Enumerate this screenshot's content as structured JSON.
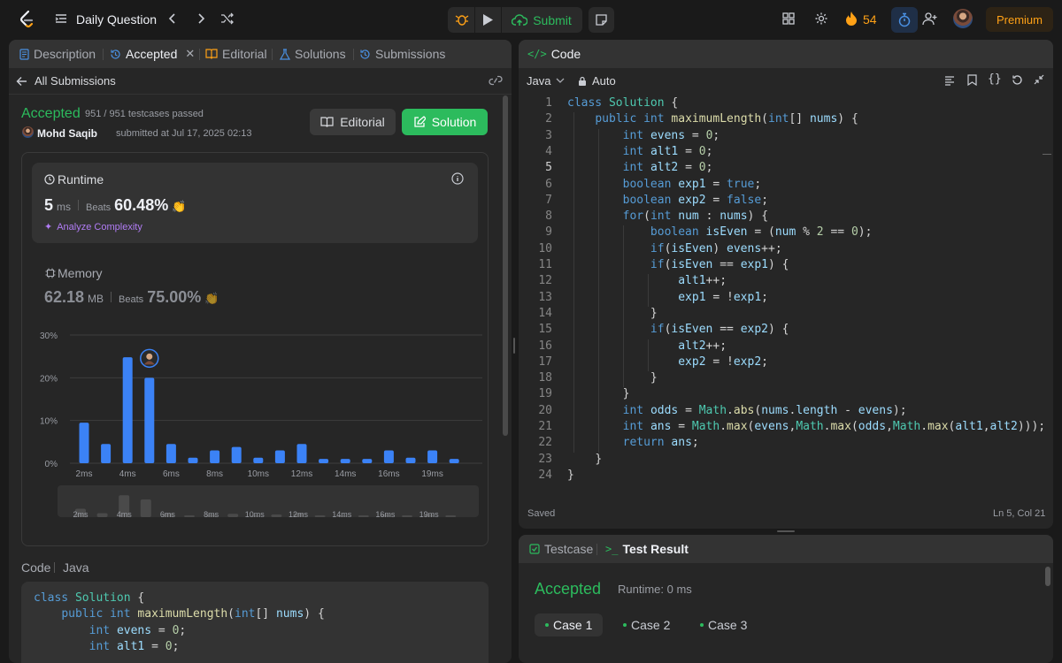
{
  "topbar": {
    "title": "Daily Question",
    "submit_label": "Submit",
    "streak": "54",
    "premium_label": "Premium"
  },
  "left_tabs": [
    {
      "label": "Description"
    },
    {
      "label": "Accepted"
    },
    {
      "label": "Editorial"
    },
    {
      "label": "Solutions"
    },
    {
      "label": "Submissions"
    }
  ],
  "submission": {
    "back_label": "All Submissions",
    "status": "Accepted",
    "testcases": "951 / 951 testcases passed",
    "user": "Mohd Saqib",
    "submitted_at": "submitted at Jul 17, 2025 02:13",
    "editorial_btn": "Editorial",
    "solution_btn": "Solution"
  },
  "runtime": {
    "label": "Runtime",
    "value": "5",
    "unit": "ms",
    "beats_label": "Beats",
    "beats": "60.48%",
    "analyze": "Analyze Complexity"
  },
  "memory": {
    "label": "Memory",
    "value": "62.18",
    "unit": "MB",
    "beats_label": "Beats",
    "beats": "75.00%"
  },
  "chart_data": {
    "type": "bar",
    "y_ticks": [
      "30%",
      "20%",
      "10%",
      "0%"
    ],
    "ylim": [
      0,
      30
    ],
    "x_labels": [
      "2ms",
      "4ms",
      "6ms",
      "8ms",
      "10ms",
      "12ms",
      "14ms",
      "16ms",
      "19ms"
    ],
    "values": [
      9.5,
      4.5,
      24.8,
      20.0,
      4.5,
      1.3,
      3.0,
      3.8,
      1.3,
      3.0,
      4.5,
      1.0,
      1.0,
      1.0,
      3.0,
      1.3,
      3.0,
      1.0
    ],
    "highlight_index": 3,
    "bar_color": "#3b82f6",
    "mini_labels": [
      "2ms",
      "4ms",
      "6ms",
      "8ms",
      "10ms",
      "12ms",
      "14ms",
      "16ms",
      "19ms"
    ]
  },
  "code_section": {
    "label": "Code",
    "lang": "Java"
  },
  "editor": {
    "tab_label": "Code",
    "lang": "Java",
    "mode": "Auto",
    "saved": "Saved",
    "position": "Ln 5, Col 21",
    "current_line": 5
  },
  "code_lines": [
    "class Solution {",
    "    public int maximumLength(int[] nums) {",
    "        int evens = 0;",
    "        int alt1 = 0;",
    "        int alt2 = 0;",
    "        boolean exp1 = true;",
    "        boolean exp2 = false;",
    "        for(int num : nums) {",
    "            boolean isEven = (num % 2 == 0);",
    "            if(isEven) evens++;",
    "            if(isEven == exp1) {",
    "                alt1++;",
    "                exp1 = !exp1;",
    "            }",
    "            if(isEven == exp2) {",
    "                alt2++;",
    "                exp2 = !exp2;",
    "            }",
    "        }",
    "        int odds = Math.abs(nums.length - evens);",
    "        int ans = Math.max(evens,Math.max(odds,Math.max(alt1,alt2)));",
    "        return ans;",
    "    }",
    "}"
  ],
  "preview_lines": [
    "class Solution {",
    "    public int maximumLength(int[] nums) {",
    "        int evens = 0;",
    "        int alt1 = 0;"
  ],
  "result": {
    "testcase_tab": "Testcase",
    "result_tab": "Test Result",
    "status": "Accepted",
    "runtime": "Runtime: 0 ms",
    "cases": [
      "Case 1",
      "Case 2",
      "Case 3"
    ]
  }
}
